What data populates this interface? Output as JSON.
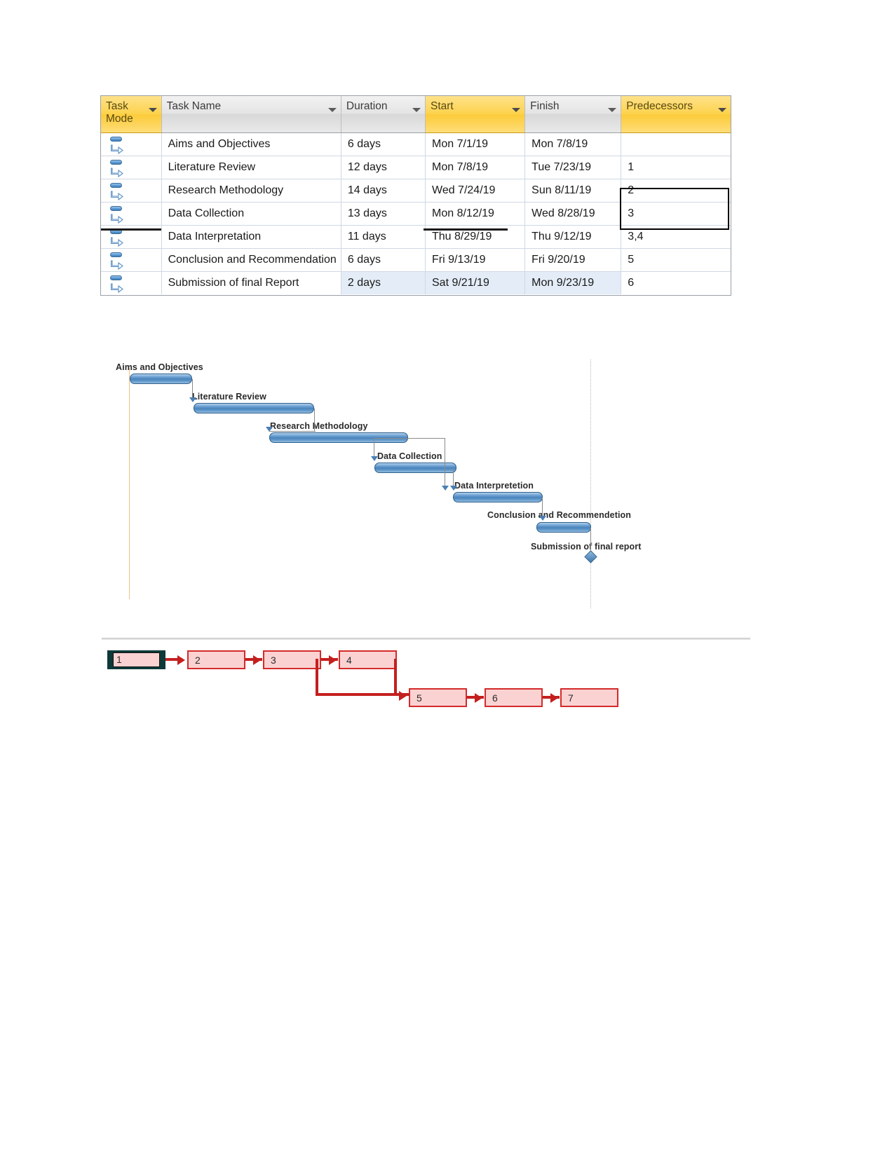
{
  "table": {
    "columns": [
      {
        "label": "Task Mode",
        "highlight": true,
        "icon": "filter-arrow-icon"
      },
      {
        "label": "Task Name",
        "highlight": false,
        "icon": "filter-arrow-icon"
      },
      {
        "label": "Duration",
        "highlight": false,
        "icon": "filter-arrow-icon"
      },
      {
        "label": "Start",
        "highlight": true,
        "icon": "filter-arrow-icon"
      },
      {
        "label": "Finish",
        "highlight": false,
        "icon": "filter-arrow-icon"
      },
      {
        "label": "Predecessors",
        "highlight": true,
        "icon": "filter-arrow-icon"
      }
    ],
    "rows": [
      {
        "mode_icon": "auto-schedule-icon",
        "name": "Aims and Objectives",
        "duration": "6 days",
        "start": "Mon 7/1/19",
        "finish": "Mon 7/8/19",
        "predecessors": ""
      },
      {
        "mode_icon": "auto-schedule-icon",
        "name": "Literature Review",
        "duration": "12 days",
        "start": "Mon 7/8/19",
        "finish": "Tue 7/23/19",
        "predecessors": "1"
      },
      {
        "mode_icon": "auto-schedule-icon",
        "name": "Research Methodology",
        "duration": "14 days",
        "start": "Wed 7/24/19",
        "finish": "Sun 8/11/19",
        "predecessors": "2"
      },
      {
        "mode_icon": "auto-schedule-icon",
        "name": "Data Collection",
        "duration": "13 days",
        "start": "Mon 8/12/19",
        "finish": "Wed 8/28/19",
        "predecessors": "3"
      },
      {
        "mode_icon": "auto-schedule-icon",
        "name": "Data Interpretation",
        "duration": "11 days",
        "start": "Thu 8/29/19",
        "finish": "Thu 9/12/19",
        "predecessors": "3,4"
      },
      {
        "mode_icon": "auto-schedule-icon",
        "name": "Conclusion and Recommendation",
        "duration": "6 days",
        "start": "Fri 9/13/19",
        "finish": "Fri 9/20/19",
        "predecessors": "5"
      },
      {
        "mode_icon": "auto-schedule-icon",
        "name": "Submission of final Report",
        "duration": "2 days",
        "start": "Sat 9/21/19",
        "finish": "Mon 9/23/19",
        "predecessors": "6",
        "selected": true
      }
    ]
  },
  "chart_data": {
    "type": "bar",
    "title": "",
    "xlabel": "",
    "ylabel": "",
    "categories": [
      "Aims and Objectives",
      "Literature Review",
      "Research Methodology",
      "Data Collection",
      "Data Interpretetion",
      "Conclusion and Recommendetion",
      "Submission of final report"
    ],
    "values": [
      6,
      12,
      14,
      13,
      11,
      6,
      2
    ],
    "bars": [
      {
        "label": "Aims and Objectives",
        "start": "Mon 7/1/19",
        "finish": "Mon 7/8/19",
        "duration_days": 6,
        "milestone": false
      },
      {
        "label": "Literature Review",
        "start": "Mon 7/8/19",
        "finish": "Tue 7/23/19",
        "duration_days": 12,
        "milestone": false
      },
      {
        "label": "Research Methodology",
        "start": "Wed 7/24/19",
        "finish": "Sun 8/11/19",
        "duration_days": 14,
        "milestone": false
      },
      {
        "label": "Data Collection",
        "start": "Mon 8/12/19",
        "finish": "Wed 8/28/19",
        "duration_days": 13,
        "milestone": false
      },
      {
        "label": "Data Interpretetion",
        "start": "Thu 8/29/19",
        "finish": "Thu 9/12/19",
        "duration_days": 11,
        "milestone": false
      },
      {
        "label": "Conclusion and Recommendetion",
        "start": "Fri 9/13/19",
        "finish": "Fri 9/20/19",
        "duration_days": 6,
        "milestone": false
      },
      {
        "label": "Submission of final report",
        "start": "Sat 9/21/19",
        "finish": "Mon 9/23/19",
        "duration_days": 2,
        "milestone": true
      }
    ],
    "bar_color": "#4b84bc",
    "link_color": "#8a8a8a",
    "grid": false,
    "legend": "none"
  },
  "network": {
    "nodes": [
      {
        "id": "1",
        "selected": true
      },
      {
        "id": "2",
        "selected": false
      },
      {
        "id": "3",
        "selected": false
      },
      {
        "id": "4",
        "selected": false
      },
      {
        "id": "5",
        "selected": false
      },
      {
        "id": "6",
        "selected": false
      },
      {
        "id": "7",
        "selected": false
      }
    ],
    "edges": [
      [
        "1",
        "2"
      ],
      [
        "2",
        "3"
      ],
      [
        "3",
        "4"
      ],
      [
        "3",
        "5"
      ],
      [
        "4",
        "5"
      ],
      [
        "5",
        "6"
      ],
      [
        "6",
        "7"
      ]
    ],
    "node_fill": "#fbd2d2",
    "node_border": "#d42a2a",
    "edge_color": "#c41f1f",
    "selected_border": "#0d3a38"
  }
}
